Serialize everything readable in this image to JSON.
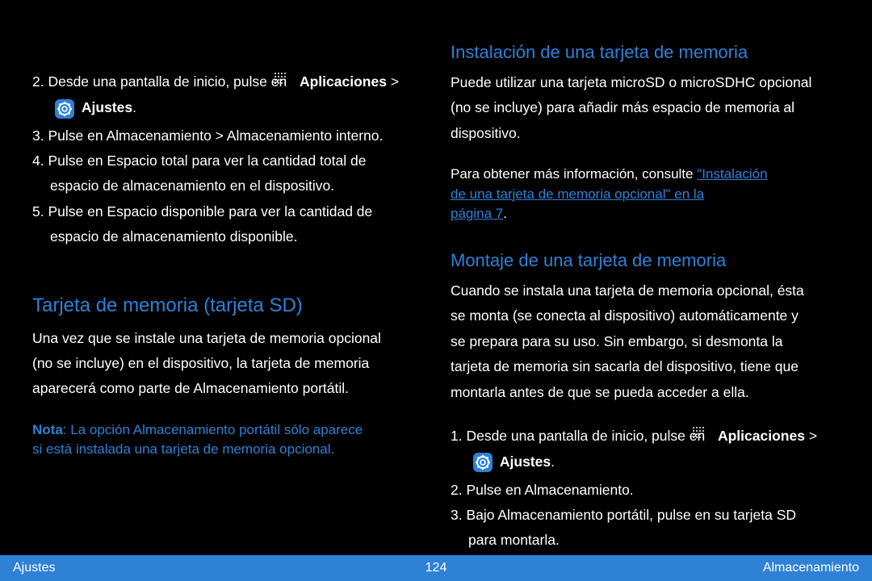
{
  "leftCol": {
    "proc1_line1_prefix": "2. Desde una pantalla de inicio, pulse en ",
    "apps_label": "Aplicaciones",
    "settings_label": "Ajustes",
    "proc1_line2_after_settings": ".",
    "proc2": "3. Pulse en Almacenamiento > Almacenamiento interno.",
    "proc3_a": "4. Pulse en Espacio total para ver la cantidad total de",
    "proc3_b": "espacio de almacenamiento en el dispositivo.",
    "proc4_a": "5. Pulse en Espacio disponible para ver la cantidad de",
    "proc4_b": "espacio de almacenamiento disponible.",
    "heading_sd": "Tarjeta de memoria (tarjeta SD)",
    "sd_p1": "Una vez que se instale una tarjeta de memoria opcional",
    "sd_p2": "(no se incluye) en el dispositivo, la tarjeta de memoria",
    "sd_p3": "aparecerá como parte de Almacenamiento portátil.",
    "note_bold": "Nota",
    "note_rest1": ": La opción Almacenamiento portátil sólo aparece",
    "note_rest2": "si está instalada una tarjeta de memoria opcional."
  },
  "rightCol": {
    "heading_install": "Instalación de una tarjeta de memoria",
    "inst_p1": "Puede utilizar una tarjeta microSD o microSDHC opcional",
    "inst_p2": "(no se incluye) para añadir más espacio de memoria al",
    "inst_p3": "dispositivo.",
    "inst_link_prefix": "Para obtener más información, consulte ",
    "inst_link1": "\"Instalación ",
    "inst_link2": "de una tarjeta de memoria opcional\" en la ",
    "inst_link3": "página 7",
    "inst_link_suffix": ".",
    "heading_mount": "Montaje de una tarjeta de memoria",
    "mount_p1": "Cuando se instala una tarjeta de memoria opcional, ésta",
    "mount_p2": "se monta (se conecta al dispositivo) automáticamente y",
    "mount_p3": "se prepara para su uso. Sin embargo, si desmonta la",
    "mount_p4": "tarjeta de memoria sin sacarla del dispositivo, tiene que",
    "mount_p5": "montarla antes de que se pueda acceder a ella.",
    "step1_prefix": "1. Desde una pantalla de inicio, pulse en ",
    "step2": "2. Pulse en Almacenamiento.",
    "step3_a": "3. Bajo Almacenamiento portátil, pulse en su tarjeta SD",
    "step3_b": "para montarla."
  },
  "footer": {
    "left": "Ajustes",
    "center": "124",
    "right": "Almacenamiento"
  }
}
